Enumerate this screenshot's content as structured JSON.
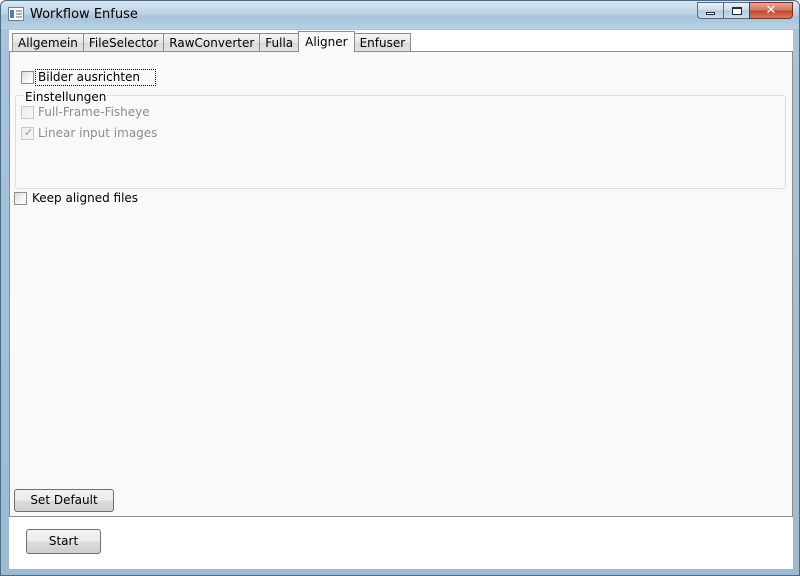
{
  "window": {
    "title": "Workflow Enfuse",
    "minimize_icon": "minimize-icon",
    "maximize_icon": "maximize-icon",
    "close_glyph": "✕"
  },
  "tabs": [
    {
      "label": "Allgemein",
      "selected": false
    },
    {
      "label": "FileSelector",
      "selected": false
    },
    {
      "label": "RawConverter",
      "selected": false
    },
    {
      "label": "Fulla",
      "selected": false
    },
    {
      "label": "Aligner",
      "selected": true
    },
    {
      "label": "Enfuser",
      "selected": false
    }
  ],
  "aligner": {
    "align_images": {
      "label": "Bilder ausrichten",
      "checked": false
    },
    "settings_group": {
      "header": "Einstellungen",
      "full_frame_fisheye": {
        "label": "Full-Frame-Fisheye",
        "checked": false,
        "enabled": false
      },
      "linear_input_images": {
        "label": "Linear input images",
        "checked": true,
        "enabled": false
      }
    },
    "keep_aligned_files": {
      "label": "Keep aligned files",
      "checked": false
    },
    "set_default_button": "Set Default"
  },
  "footer": {
    "start_button": "Start"
  }
}
